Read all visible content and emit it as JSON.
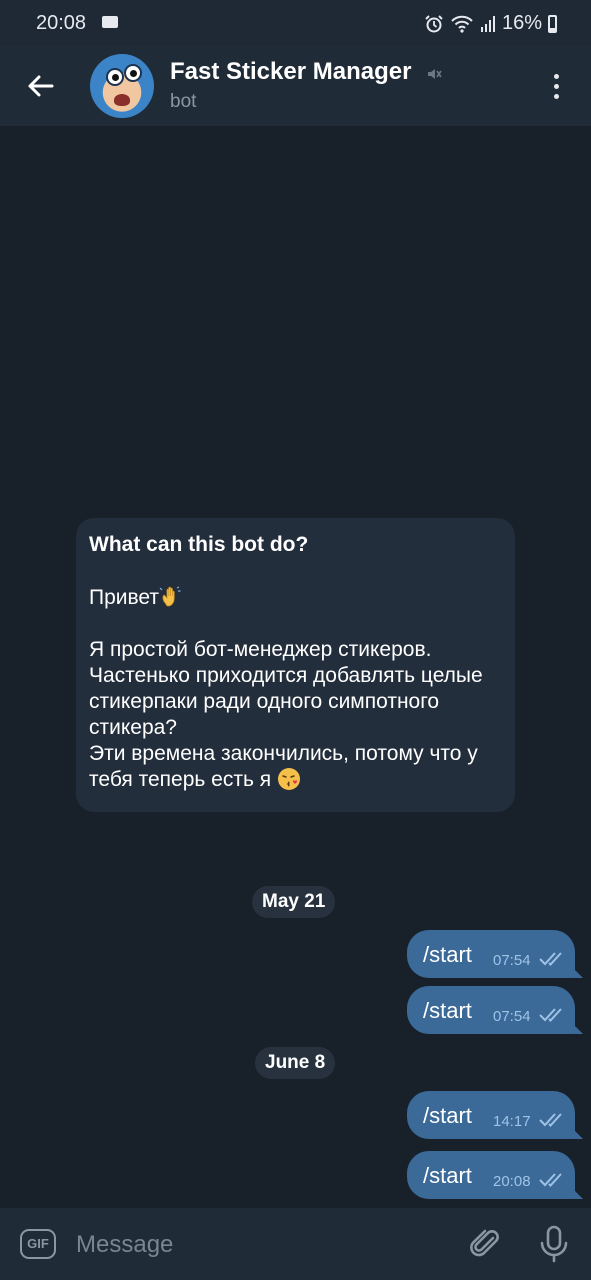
{
  "status_bar": {
    "time": "20:08",
    "battery": "16%",
    "icons": [
      "folder-icon",
      "alarm-icon",
      "wifi-icon",
      "signal-icon",
      "battery-icon"
    ]
  },
  "header": {
    "title": "Fast Sticker Manager",
    "subtitle": "bot",
    "icons": [
      "back-arrow-icon",
      "muted-speaker-icon",
      "more-vertical-icon"
    ]
  },
  "info_card": {
    "title": "What can this bot do?",
    "greeting": "Привет",
    "body": "Я простой бот-менеджер стикеров.\nЧастенько приходится добавлять целые стикерпаки ради одного симпотного стикера?\nЭти времена закончились, потому что у тебя теперь есть я",
    "emoji_1": "waving-hand",
    "emoji_2": "face-blowing-kiss"
  },
  "messages": {
    "date_1": "May 21",
    "date_2": "June 8",
    "items": [
      {
        "text": "/start",
        "time": "07:54"
      },
      {
        "text": "/start",
        "time": "07:54"
      },
      {
        "text": "/start",
        "time": "14:17"
      },
      {
        "text": "/start",
        "time": "20:08"
      }
    ]
  },
  "input": {
    "gif_label": "GIF",
    "placeholder": "Message"
  },
  "colors": {
    "background": "#18202a",
    "header": "#202b38",
    "incoming_bubble": "#232e3c",
    "outgoing_bubble": "#3b6a99",
    "read_check": "#9ec3e6"
  }
}
